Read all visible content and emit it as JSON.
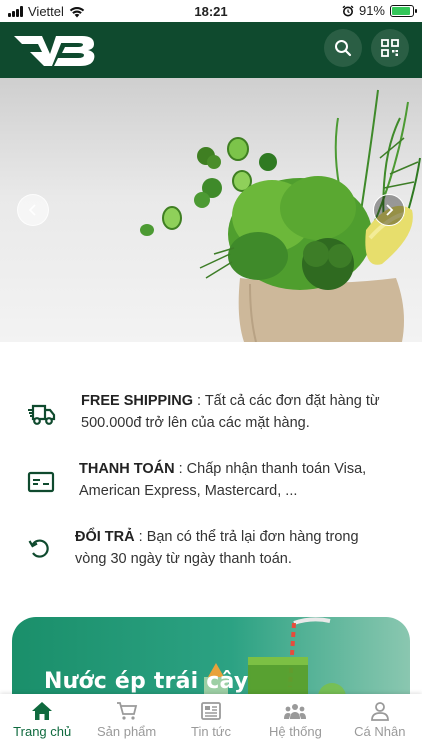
{
  "status_bar": {
    "carrier": "Viettel",
    "time": "18:21",
    "battery": "91%",
    "battery_level": 0.91
  },
  "header": {
    "logo_icon": "vb-logo",
    "search_icon": "search-icon",
    "qr_icon": "qr-icon"
  },
  "banner": {
    "prev_icon": "chevron-left-icon",
    "next_icon": "chevron-right-icon"
  },
  "features": [
    {
      "icon": "delivery-truck-icon",
      "title": "FREE SHIPPING",
      "text": " : Tất cả các đơn đặt hàng từ 500.000đ trở lên của các mặt hàng."
    },
    {
      "icon": "credit-card-icon",
      "title": "THANH TOÁN",
      "text": " : Chấp nhận thanh toán Visa, American Express, Mastercard, ..."
    },
    {
      "icon": "return-icon",
      "title": "ĐỔI TRẢ",
      "text": " : Bạn có thể trả lại đơn hàng trong vòng 30 ngày từ ngày thanh toán."
    }
  ],
  "promo": {
    "title": "Nước ép trái cây"
  },
  "tabs": [
    {
      "label": "Trang chủ",
      "icon": "home-icon",
      "active": true
    },
    {
      "label": "Sản phẩm",
      "icon": "cart-icon",
      "active": false
    },
    {
      "label": "Tin tức",
      "icon": "news-icon",
      "active": false
    },
    {
      "label": "Hệ thống",
      "icon": "people-icon",
      "active": false
    },
    {
      "label": "Cá Nhân",
      "icon": "user-icon",
      "active": false
    }
  ],
  "colors": {
    "brand": "#0f4a2e",
    "accent": "#0f6a3e",
    "inactive": "#9a9a9a"
  }
}
